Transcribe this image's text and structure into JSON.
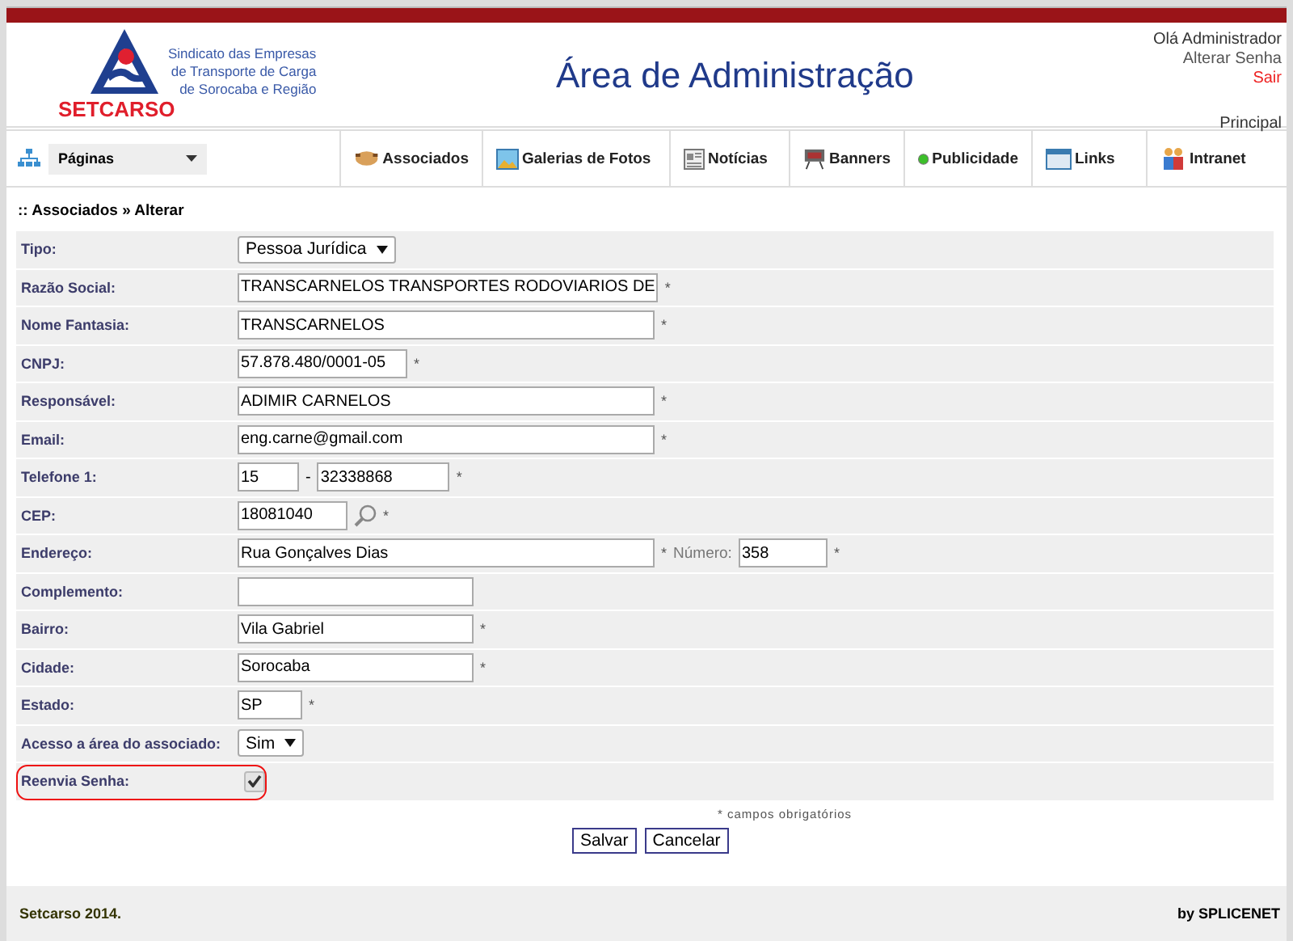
{
  "header": {
    "logo_name": "SETCARSO",
    "logo_tagline": [
      "Sindicato das Empresas",
      "de Transporte de Carga",
      "de Sorocaba e Região"
    ],
    "title": "Área de Administração",
    "greeting": "Olá Administrador",
    "change_password": "Alterar Senha",
    "logout": "Sair",
    "home": "Principal"
  },
  "nav": {
    "pages_dropdown": "Páginas",
    "items": [
      {
        "label": "Associados"
      },
      {
        "label": "Galerias de Fotos"
      },
      {
        "label": "Notícias"
      },
      {
        "label": "Banners"
      },
      {
        "label": "Publicidade"
      },
      {
        "label": "Links"
      },
      {
        "label": "Intranet"
      }
    ]
  },
  "breadcrumb": ":: Associados » Alterar",
  "form": {
    "rows": [
      {
        "label": "Tipo:",
        "kind": "select",
        "value": "Pessoa Jurídica"
      },
      {
        "label": "Razão Social:",
        "kind": "text",
        "value": "TRANSCARNELOS TRANSPORTES RODOVIARIOS DE",
        "required": "*"
      },
      {
        "label": "Nome Fantasia:",
        "kind": "text",
        "value": "TRANSCARNELOS",
        "required": "*"
      },
      {
        "label": "CNPJ:",
        "kind": "text",
        "value": "57.878.480/0001-05",
        "required": "*"
      },
      {
        "label": "Responsável:",
        "kind": "text",
        "value": "ADIMIR CARNELOS",
        "required": "*"
      },
      {
        "label": "Email:",
        "kind": "text",
        "value": "eng.carne@gmail.com",
        "required": "*"
      },
      {
        "label": "Telefone 1:",
        "kind": "phone",
        "area": "15",
        "separator": "-",
        "value": "32338868",
        "required": "*"
      },
      {
        "label": "CEP:",
        "kind": "cep",
        "value": "18081040",
        "required": "*"
      },
      {
        "label": "Endereço:",
        "kind": "address",
        "value": "Rua Gonçalves Dias",
        "required": "*",
        "number_label": "Número:",
        "number": "358",
        "number_required": "*"
      },
      {
        "label": "Complemento:",
        "kind": "text",
        "value": ""
      },
      {
        "label": "Bairro:",
        "kind": "text",
        "value": "Vila Gabriel",
        "required": "*"
      },
      {
        "label": "Cidade:",
        "kind": "text",
        "value": "Sorocaba",
        "required": "*"
      },
      {
        "label": "Estado:",
        "kind": "text",
        "value": "SP",
        "required": "*"
      },
      {
        "label": "Acesso a área do associado:",
        "kind": "select",
        "value": "Sim"
      },
      {
        "label": "Reenvia Senha:",
        "kind": "checkbox",
        "checked": true,
        "highlighted": true
      }
    ],
    "required_note": "* campos obrigatórios",
    "buttons": [
      "Salvar",
      "Cancelar"
    ]
  },
  "footer": {
    "copyright": "Setcarso 2014.",
    "credit": "by SPLICENET"
  }
}
